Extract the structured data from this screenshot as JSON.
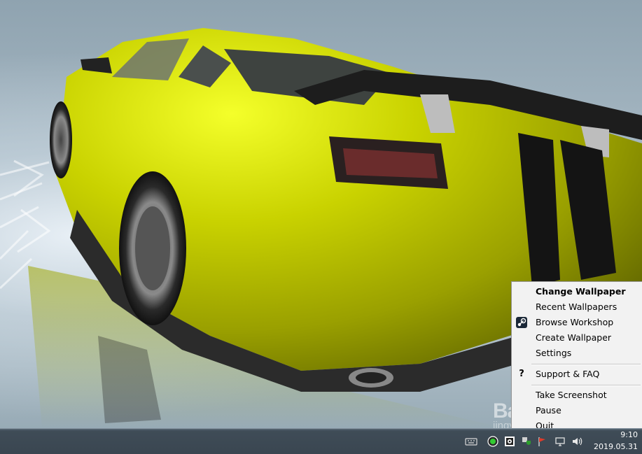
{
  "menu": {
    "items": [
      {
        "label": "Change Wallpaper",
        "icon": ""
      },
      {
        "label": "Recent Wallpapers",
        "icon": ""
      },
      {
        "label": "Browse Workshop",
        "icon": "steam-icon"
      },
      {
        "label": "Create Wallpaper",
        "icon": ""
      },
      {
        "label": "Settings",
        "icon": ""
      },
      {
        "label": "Support & FAQ",
        "icon": "question-icon"
      },
      {
        "label": "Take Screenshot",
        "icon": ""
      },
      {
        "label": "Pause",
        "icon": ""
      },
      {
        "label": "Quit",
        "icon": ""
      }
    ]
  },
  "taskbar": {
    "tray_icons": [
      "keyboard-icon",
      "wallpaper-engine-icon",
      "gear-icon",
      "network-shield-icon",
      "flag-icon",
      "display-icon",
      "volume-icon"
    ],
    "clock": {
      "time": "9:10",
      "date": "2019.05.31"
    }
  },
  "watermark": {
    "logo": "Baidu 经验",
    "url": "jingyan.baidu.com"
  },
  "colors": {
    "car_body": "#c8d000",
    "car_stripe": "#141414",
    "menu_bg": "#f2f2f2",
    "taskbar_bg": "#3a4651"
  }
}
